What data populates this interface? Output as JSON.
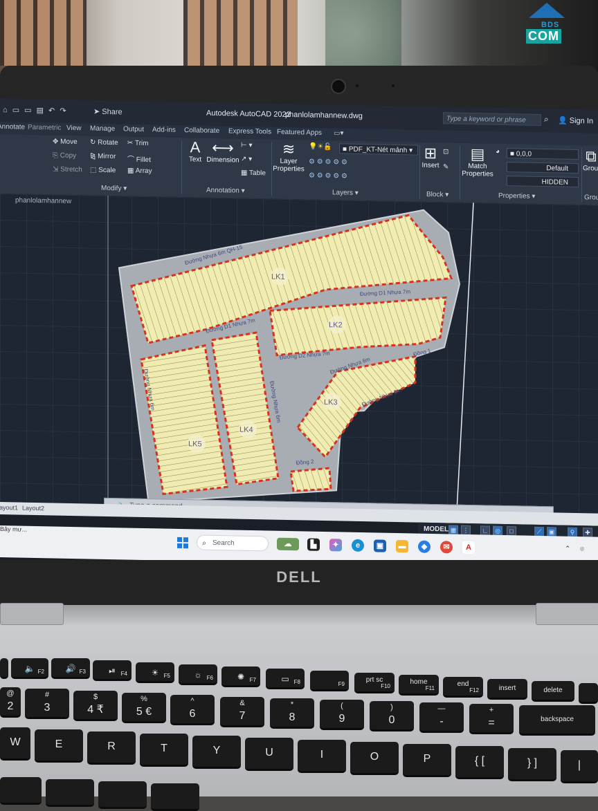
{
  "watermark": {
    "top": "BDS",
    "bottom": "COM"
  },
  "titlebar": {
    "quick_access": "⌂ ▭ ▭ ▤ ↶ ↷",
    "share": "Share",
    "app_title": "Autodesk AutoCAD 2022",
    "file_name": "phanlolamhannew.dwg",
    "search_placeholder": "Type a keyword or phrase",
    "sign_in": "Sign In"
  },
  "ribbon_tabs": [
    "Annotate",
    "Parametric",
    "View",
    "Manage",
    "Output",
    "Add-ins",
    "Collaborate",
    "Express Tools",
    "Featured Apps"
  ],
  "ribbon": {
    "modify": {
      "move": "Move",
      "rotate": "Rotate",
      "trim": "Trim",
      "copy": "Copy",
      "mirror": "Mirror",
      "fillet": "Fillet",
      "stretch": "Stretch",
      "scale": "Scale",
      "array": "Array",
      "panel_label": "Modify"
    },
    "annotation": {
      "text": "Text",
      "dimension": "Dimension",
      "table": "Table",
      "panel_label": "Annotation"
    },
    "layers": {
      "layer_properties_1": "Layer",
      "layer_properties_2": "Properties",
      "current_layer": "PDF_KT-Nét mảnh",
      "panel_label": "Layers"
    },
    "block": {
      "insert": "Insert",
      "panel_label": "Block"
    },
    "properties": {
      "match_1": "Match",
      "match_2": "Properties",
      "color": "0,0,0",
      "linetype": "Default",
      "lineweight": "HIDDEN",
      "panel_label": "Properties"
    },
    "groups": {
      "label_1": "Group",
      "panel_label": "Grou"
    }
  },
  "drawing": {
    "doc_tab": "phanlolamhannew",
    "block_labels": [
      "LK1",
      "LK2",
      "LK3",
      "LK4",
      "LK5"
    ],
    "road_labels": {
      "north": "Đường Nhựa 6m QH-15",
      "d1": "Đường D1 Nhựa 7m",
      "d1_west": "Đường D1 Nhựa 7m",
      "d2": "Đường D2 Nhựa 7m",
      "mid": "Đường Nhựa 6m",
      "south_east": "Đường Nhựa 6m",
      "dong1": "Đồng 1",
      "dong2": "Đồng 2",
      "west": "Đường Nhựa 6m",
      "center": "Đường Nhựa 6m"
    }
  },
  "command_line": {
    "placeholder": "Type a command"
  },
  "layout_tabs": [
    "Layout1",
    "Layout2"
  ],
  "status": {
    "model": "MODEL"
  },
  "taskbar": {
    "left_text": "Bây mư...",
    "search": "Search"
  },
  "laptop_brand": "DELL",
  "keyboard": {
    "fn_row": [
      {
        "icon": "🔈",
        "fn": "F2"
      },
      {
        "icon": "🔊",
        "fn": "F3"
      },
      {
        "icon": "⏯",
        "fn": "F4"
      },
      {
        "icon": "☀",
        "fn": "F5"
      },
      {
        "icon": "☼",
        "fn": "F6"
      },
      {
        "icon": "✺",
        "fn": "F7"
      },
      {
        "icon": "▭",
        "fn": "F8"
      },
      {
        "icon": "",
        "fn": "F9"
      },
      {
        "label": "prt sc",
        "fn": "F10"
      },
      {
        "label": "home",
        "fn": "F11"
      },
      {
        "label": "end",
        "fn": "F12"
      },
      {
        "label": "insert",
        "fn": ""
      },
      {
        "label": "delete",
        "fn": ""
      }
    ],
    "num_row": [
      {
        "top": "@",
        "main": "2"
      },
      {
        "top": "#",
        "main": "3"
      },
      {
        "top": "$",
        "main": "4 ₹"
      },
      {
        "top": "%",
        "main": "5 €"
      },
      {
        "top": "^",
        "main": "6"
      },
      {
        "top": "&",
        "main": "7"
      },
      {
        "top": "*",
        "main": "8"
      },
      {
        "top": "(",
        "main": "9"
      },
      {
        "top": ")",
        "main": "0"
      },
      {
        "top": "—",
        "main": "-"
      },
      {
        "top": "+",
        "main": "="
      },
      {
        "top": "",
        "main": "backspace"
      }
    ],
    "qwerty_row": [
      "W",
      "E",
      "R",
      "T",
      "Y",
      "U",
      "I",
      "O",
      "P",
      "{ [",
      "} ]",
      "|"
    ]
  }
}
